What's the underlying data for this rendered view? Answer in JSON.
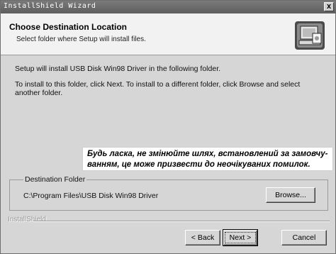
{
  "window": {
    "title": "InstallShield Wizard",
    "close_glyph": "x"
  },
  "header": {
    "title": "Choose Destination Location",
    "subtitle": "Select folder where Setup will install files.",
    "icon": "computer-install-icon"
  },
  "body": {
    "line1": "Setup will install USB Disk Win98 Driver in the following folder.",
    "line2": "To install to this folder, click Next. To install to a different folder, click Browse and select",
    "line3": "another folder."
  },
  "overlay_note": {
    "line1": "Будь ласка, не змінюйте шлях, встановлений за замовчу-",
    "line2": "ванням, це може призвести до неочікуваних помилок."
  },
  "destination": {
    "group_label": "Destination Folder",
    "path": "C:\\Program Files\\USB Disk Win98 Driver",
    "browse_label": "Browse..."
  },
  "footer": {
    "brand": "InstallShield",
    "back_label": "< Back",
    "next_label": "Next >",
    "cancel_label": "Cancel"
  }
}
